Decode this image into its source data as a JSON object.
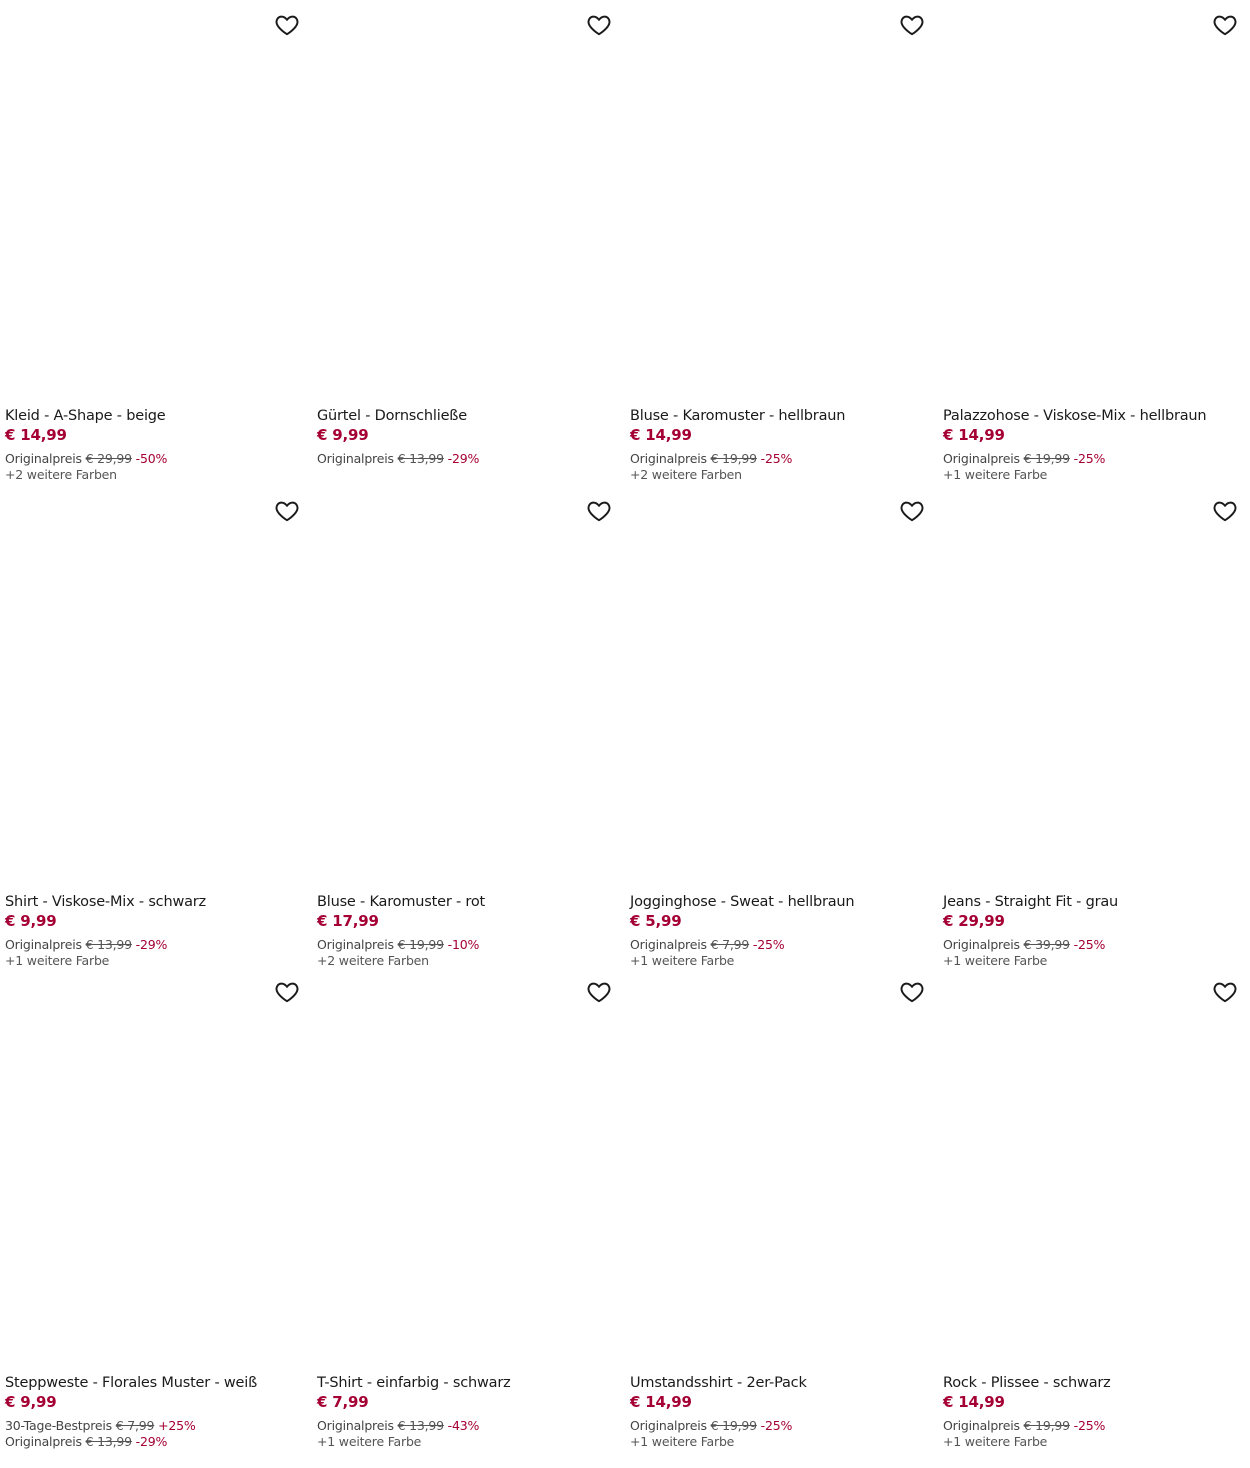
{
  "accent_color": "#a50034",
  "wishlist_icon": "heart-outline-icon",
  "products": [
    {
      "title": "Kleid - A-Shape - beige",
      "price": "€ 14,99",
      "lines": [
        {
          "label": "Originalpreis",
          "old": "€ 29,99",
          "pct": "-50%"
        }
      ],
      "colors": "+2 weitere Farben"
    },
    {
      "title": "Gürtel - Dornschließe",
      "price": "€ 9,99",
      "lines": [
        {
          "label": "Originalpreis",
          "old": "€ 13,99",
          "pct": "-29%"
        }
      ],
      "colors": ""
    },
    {
      "title": "Bluse - Karomuster - hellbraun",
      "price": "€ 14,99",
      "lines": [
        {
          "label": "Originalpreis",
          "old": "€ 19,99",
          "pct": "-25%"
        }
      ],
      "colors": "+2 weitere Farben"
    },
    {
      "title": "Palazzohose - Viskose-Mix - hellbraun",
      "price": "€ 14,99",
      "lines": [
        {
          "label": "Originalpreis",
          "old": "€ 19,99",
          "pct": "-25%"
        }
      ],
      "colors": "+1 weitere Farbe"
    },
    {
      "title": "Shirt - Viskose-Mix - schwarz",
      "price": "€ 9,99",
      "lines": [
        {
          "label": "Originalpreis",
          "old": "€ 13,99",
          "pct": "-29%"
        }
      ],
      "colors": "+1 weitere Farbe"
    },
    {
      "title": "Bluse - Karomuster - rot",
      "price": "€ 17,99",
      "lines": [
        {
          "label": "Originalpreis",
          "old": "€ 19,99",
          "pct": "-10%"
        }
      ],
      "colors": "+2 weitere Farben"
    },
    {
      "title": "Jogginghose - Sweat - hellbraun",
      "price": "€ 5,99",
      "lines": [
        {
          "label": "Originalpreis",
          "old": "€ 7,99",
          "pct": "-25%"
        }
      ],
      "colors": "+1 weitere Farbe"
    },
    {
      "title": "Jeans - Straight Fit - grau",
      "price": "€ 29,99",
      "lines": [
        {
          "label": "Originalpreis",
          "old": "€ 39,99",
          "pct": "-25%"
        }
      ],
      "colors": "+1 weitere Farbe"
    },
    {
      "title": "Steppweste - Florales Muster - weiß",
      "price": "€ 9,99",
      "lines": [
        {
          "label": "30-Tage-Bestpreis",
          "old": "€ 7,99",
          "pct": "+25%"
        },
        {
          "label": "Originalpreis",
          "old": "€ 13,99",
          "pct": "-29%"
        }
      ],
      "colors": ""
    },
    {
      "title": "T-Shirt - einfarbig - schwarz",
      "price": "€ 7,99",
      "lines": [
        {
          "label": "Originalpreis",
          "old": "€ 13,99",
          "pct": "-43%"
        }
      ],
      "colors": "+1 weitere Farbe"
    },
    {
      "title": "Umstandsshirt - 2er-Pack",
      "price": "€ 14,99",
      "lines": [
        {
          "label": "Originalpreis",
          "old": "€ 19,99",
          "pct": "-25%"
        }
      ],
      "colors": "+1 weitere Farbe"
    },
    {
      "title": "Rock - Plissee - schwarz",
      "price": "€ 14,99",
      "lines": [
        {
          "label": "Originalpreis",
          "old": "€ 19,99",
          "pct": "-25%"
        }
      ],
      "colors": "+1 weitere Farbe"
    }
  ]
}
